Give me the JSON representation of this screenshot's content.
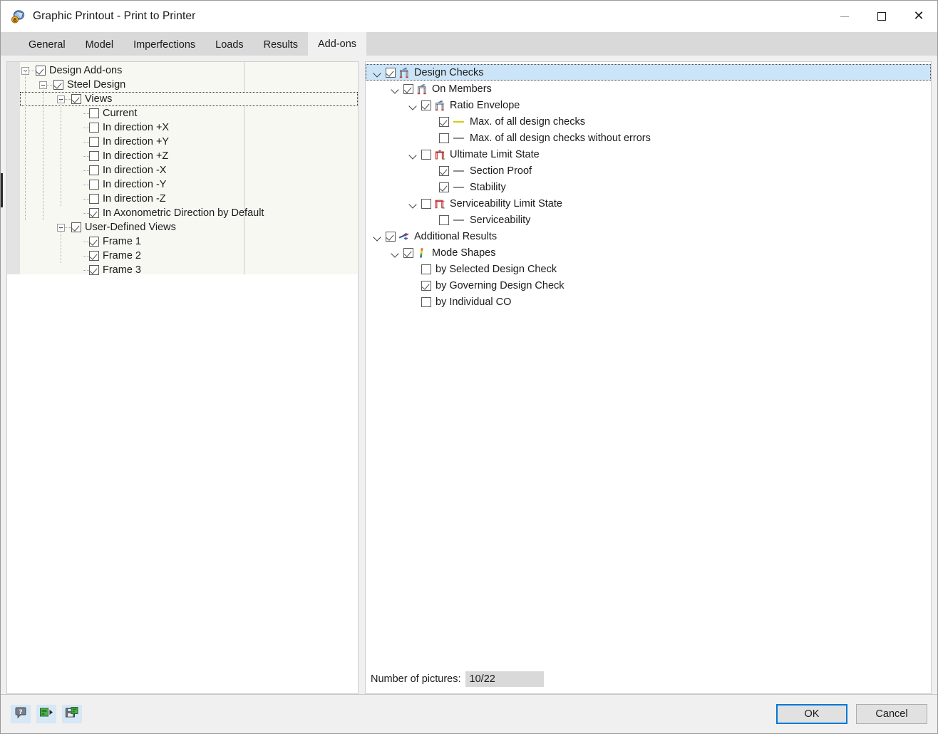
{
  "window": {
    "title": "Graphic Printout - Print to Printer",
    "app_icon": "graphic-printout-icon",
    "minimize_label": "Minimize",
    "maximize_label": "Maximize",
    "close_label": "Close"
  },
  "tabs": [
    {
      "label": "General",
      "active": false
    },
    {
      "label": "Model",
      "active": false
    },
    {
      "label": "Imperfections",
      "active": false
    },
    {
      "label": "Loads",
      "active": false
    },
    {
      "label": "Results",
      "active": false
    },
    {
      "label": "Add-ons",
      "active": true
    }
  ],
  "left_tree": {
    "items": [
      {
        "label": "Design Add-ons",
        "indent": 0,
        "expander": "minus",
        "checked": true,
        "selected": false
      },
      {
        "label": "Steel Design",
        "indent": 1,
        "expander": "minus",
        "checked": true,
        "selected": false
      },
      {
        "label": "Views",
        "indent": 2,
        "expander": "minus",
        "checked": true,
        "selected": true
      },
      {
        "label": "Current",
        "indent": 3,
        "expander": "none",
        "checked": false,
        "selected": false
      },
      {
        "label": "In direction +X",
        "indent": 3,
        "expander": "none",
        "checked": false,
        "selected": false
      },
      {
        "label": "In direction +Y",
        "indent": 3,
        "expander": "none",
        "checked": false,
        "selected": false
      },
      {
        "label": "In direction +Z",
        "indent": 3,
        "expander": "none",
        "checked": false,
        "selected": false
      },
      {
        "label": "In direction -X",
        "indent": 3,
        "expander": "none",
        "checked": false,
        "selected": false
      },
      {
        "label": "In direction -Y",
        "indent": 3,
        "expander": "none",
        "checked": false,
        "selected": false
      },
      {
        "label": "In direction -Z",
        "indent": 3,
        "expander": "none",
        "checked": false,
        "selected": false
      },
      {
        "label": "In Axonometric Direction by Default",
        "indent": 3,
        "expander": "none",
        "checked": true,
        "selected": false
      },
      {
        "label": "User-Defined Views",
        "indent": 2,
        "expander": "minus",
        "checked": true,
        "selected": false
      },
      {
        "label": "Frame 1",
        "indent": 3,
        "expander": "none",
        "checked": true,
        "selected": false
      },
      {
        "label": "Frame 2",
        "indent": 3,
        "expander": "none",
        "checked": true,
        "selected": false
      },
      {
        "label": "Frame 3",
        "indent": 3,
        "expander": "none",
        "checked": true,
        "selected": false
      }
    ]
  },
  "right_tree": {
    "items": [
      {
        "label": "Design Checks",
        "indent": 0,
        "chevron": true,
        "checked": true,
        "icon": "design-check-member-icon",
        "swatch": null,
        "highlight": true
      },
      {
        "label": "On Members",
        "indent": 1,
        "chevron": true,
        "checked": true,
        "icon": "design-check-member-icon",
        "swatch": null,
        "highlight": false
      },
      {
        "label": "Ratio Envelope",
        "indent": 2,
        "chevron": true,
        "checked": true,
        "icon": "design-check-member-icon",
        "swatch": null,
        "highlight": false
      },
      {
        "label": "Max. of all design checks",
        "indent": 3,
        "chevron": false,
        "checked": true,
        "icon": null,
        "swatch": "#d8cc12",
        "highlight": false
      },
      {
        "label": "Max. of all design checks without errors",
        "indent": 3,
        "chevron": false,
        "checked": false,
        "icon": null,
        "swatch": "#8e8e8e",
        "highlight": false
      },
      {
        "label": "Ultimate Limit State",
        "indent": 2,
        "chevron": true,
        "checked": false,
        "icon": "ultimate-limit-state-icon",
        "swatch": null,
        "highlight": false
      },
      {
        "label": "Section Proof",
        "indent": 3,
        "chevron": false,
        "checked": true,
        "icon": null,
        "swatch": "#8e8e8e",
        "highlight": false
      },
      {
        "label": "Stability",
        "indent": 3,
        "chevron": false,
        "checked": true,
        "icon": null,
        "swatch": "#8e8e8e",
        "highlight": false
      },
      {
        "label": "Serviceability Limit State",
        "indent": 2,
        "chevron": true,
        "checked": false,
        "icon": "serviceability-limit-state-icon",
        "swatch": null,
        "highlight": false
      },
      {
        "label": "Serviceability",
        "indent": 3,
        "chevron": false,
        "checked": false,
        "icon": null,
        "swatch": "#8e8e8e",
        "highlight": false
      },
      {
        "label": "Additional Results",
        "indent": 0,
        "chevron": true,
        "checked": true,
        "icon": "additional-results-icon",
        "swatch": null,
        "highlight": false
      },
      {
        "label": "Mode Shapes",
        "indent": 1,
        "chevron": true,
        "checked": true,
        "icon": "mode-shapes-icon",
        "swatch": null,
        "highlight": false
      },
      {
        "label": "by Selected Design Check",
        "indent": 2,
        "chevron": false,
        "checked": false,
        "icon": null,
        "swatch": null,
        "highlight": false
      },
      {
        "label": "by Governing Design Check",
        "indent": 2,
        "chevron": false,
        "checked": true,
        "icon": null,
        "swatch": null,
        "highlight": false
      },
      {
        "label": "by Individual CO",
        "indent": 2,
        "chevron": false,
        "checked": false,
        "icon": null,
        "swatch": null,
        "highlight": false
      }
    ]
  },
  "pictures": {
    "label": "Number of pictures:",
    "value": "10/22"
  },
  "footer": {
    "tools": [
      {
        "name": "help-icon",
        "title": "Help"
      },
      {
        "name": "run-green-icon",
        "title": "Run"
      },
      {
        "name": "save-green-icon",
        "title": "Save"
      }
    ],
    "ok_label": "OK",
    "cancel_label": "Cancel"
  },
  "colors": {
    "accent": "#0078d7",
    "selection": "#cce4f7",
    "tool_bg": "#d6e7f6",
    "yellow_line": "#d8cc12",
    "grey_line": "#8e8e8e"
  }
}
